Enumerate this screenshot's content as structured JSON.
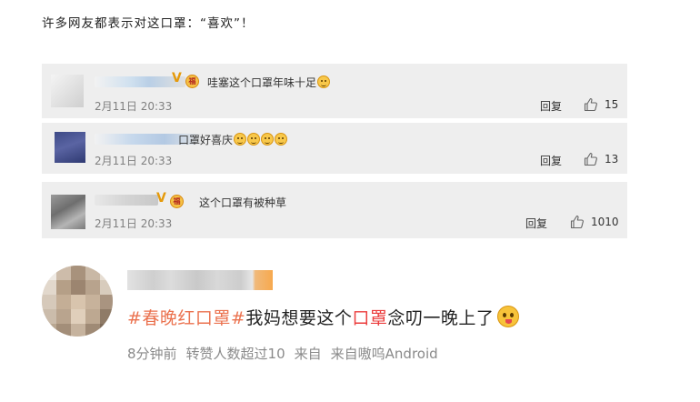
{
  "heading": "许多网友都表示对这口罩：“喜欢”！",
  "comments": [
    {
      "text": "哇塞这个口罩年味十足",
      "time": "2月11日 20:33",
      "reply": "回复",
      "likes": "15"
    },
    {
      "text": "口罩好喜庆",
      "time": "2月11日 20:33",
      "reply": "回复",
      "likes": "13"
    },
    {
      "text": "这个口罩有被种草",
      "time": "2月11日 20:33",
      "reply": "回复",
      "likes": "1010"
    }
  ],
  "post": {
    "hashtag": "#春晚红口罩#",
    "text_before": "我妈想要这个",
    "highlight": "口罩",
    "text_after": "念叨一晚上了",
    "time": "8分钟前",
    "reposts": "转赞人数超过10",
    "source1": "来自",
    "source2": "来自嗷呜Android"
  },
  "icons": {
    "vip": "V",
    "like": "thumbs-up-icon"
  }
}
